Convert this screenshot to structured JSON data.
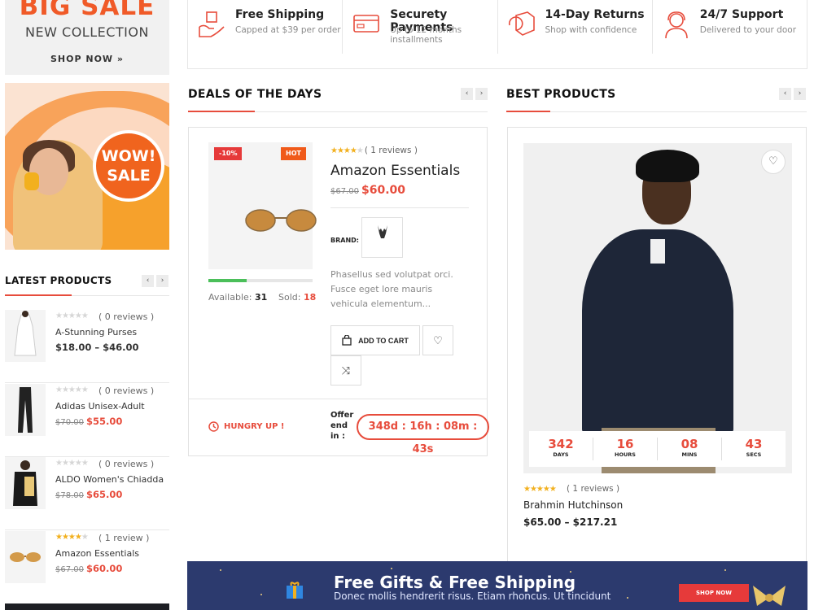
{
  "promo_top": {
    "headline": "BIG SALE",
    "subline": "NEW COLLECTION",
    "cta": "SHOP NOW »"
  },
  "wow_banner": {
    "line1": "WOW!",
    "line2": "SALE"
  },
  "features": [
    {
      "title": "Free Shipping",
      "subtitle": "Capped at $39 per order",
      "icon": "delivery-box-icon"
    },
    {
      "title": "Securety Payments",
      "subtitle": "Up to 12 months installments",
      "icon": "credit-card-icon"
    },
    {
      "title": "14-Day Returns",
      "subtitle": "Shop with confidence",
      "icon": "return-box-icon"
    },
    {
      "title": "24/7 Support",
      "subtitle": "Delivered to your door",
      "icon": "headset-icon"
    }
  ],
  "latest": {
    "title": "LATEST PRODUCTS",
    "items": [
      {
        "reviews": "( 0 reviews )",
        "name": "A-Stunning Purses",
        "price": "$18.00 – $46.00",
        "old_price": "",
        "new_price": "",
        "rating": 0
      },
      {
        "reviews": "( 0 reviews )",
        "name": "Adidas Unisex-Adult",
        "price": "",
        "old_price": "$70.00",
        "new_price": "$55.00",
        "rating": 0
      },
      {
        "reviews": "( 0 reviews )",
        "name": "ALDO Women's Chiadda",
        "price": "",
        "old_price": "$78.00",
        "new_price": "$65.00",
        "rating": 0
      },
      {
        "reviews": "( 1 review )",
        "name": "Amazon Essentials",
        "price": "",
        "old_price": "$67.00",
        "new_price": "$60.00",
        "rating": 4
      }
    ]
  },
  "deals": {
    "title": "DEALS OF THE DAYS",
    "badge_sale": "-10%",
    "badge_hot": "HOT",
    "rating": 4,
    "reviews": "( 1 reviews )",
    "name": "Amazon Essentials",
    "old_price": "$67.00",
    "new_price": "$60.00",
    "brand_label": "BRAND:",
    "description": "Phasellus sed volutpat orci. Fusce eget lore mauris vehicula elementum...",
    "available_label": "Available:",
    "available": "31",
    "sold_label": "Sold:",
    "sold": "18",
    "sold_fraction": 0.37,
    "add_to_cart": "ADD TO CART",
    "hungry": "HUNGRY UP !",
    "offer_label": "Offer end in :",
    "timer": "348d : 16h : 08m : 43s"
  },
  "best": {
    "title": "BEST PRODUCTS",
    "countdown": [
      {
        "num": "342",
        "label": "DAYS"
      },
      {
        "num": "16",
        "label": "HOURS"
      },
      {
        "num": "08",
        "label": "MINS"
      },
      {
        "num": "43",
        "label": "SECS"
      }
    ],
    "rating": 5,
    "reviews": "( 1 reviews )",
    "name": "Brahmin Hutchinson",
    "price": "$65.00 – $217.21"
  },
  "bottom_banner": {
    "title": "Free Gifts & Free Shipping",
    "subtitle": "Donec mollis hendrerit risus. Etiam rhoncus. Ut tincidunt",
    "cta": "SHOP NOW"
  },
  "colors": {
    "accent": "#e74c3c",
    "orange": "#f05a28",
    "banner": "#2c3a6e",
    "star": "#f2b01e",
    "progress": "#4bbf5a"
  }
}
